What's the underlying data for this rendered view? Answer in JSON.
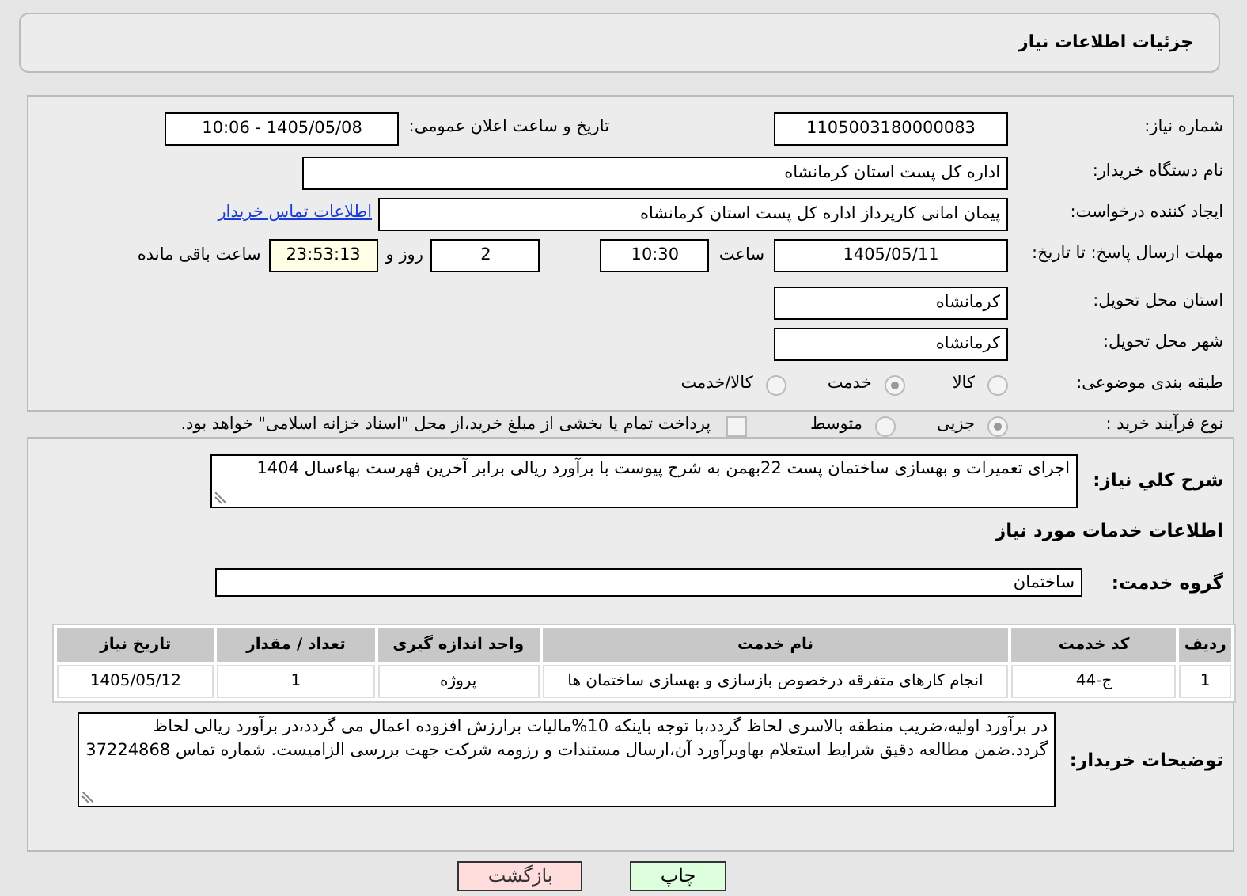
{
  "header": {
    "title": "جزئیات اطلاعات نیاز"
  },
  "need_number": {
    "label": "شماره نیاز:",
    "value": "1105003180000083"
  },
  "announce": {
    "label": "تاریخ و ساعت اعلان عمومی:",
    "value": "1405/05/08 - 10:06"
  },
  "buyer_org": {
    "label": "نام دستگاه خریدار:",
    "value": "اداره کل پست استان کرمانشاه"
  },
  "requester": {
    "label": "ایجاد کننده درخواست:",
    "value": "پیمان امانی کارپرداز اداره کل پست استان کرمانشاه",
    "link": "اطلاعات تماس خریدار"
  },
  "deadline": {
    "label": "مهلت ارسال پاسخ: تا تاریخ:",
    "date": "1405/05/11",
    "time_label": "ساعت",
    "time": "10:30",
    "days": "2",
    "days_label": "روز و",
    "remaining": "23:53:13",
    "remaining_label": "ساعت باقی مانده"
  },
  "province": {
    "label": "استان محل تحویل:",
    "value": "کرمانشاه"
  },
  "city": {
    "label": "شهر محل تحویل:",
    "value": "کرمانشاه"
  },
  "category": {
    "label": "طبقه بندی موضوعی:",
    "options": [
      {
        "label": "کالا",
        "selected": false
      },
      {
        "label": "خدمت",
        "selected": true
      },
      {
        "label": "کالا/خدمت",
        "selected": false
      }
    ]
  },
  "process": {
    "label": "نوع فرآیند خرید :",
    "options": [
      {
        "label": "جزیی",
        "selected": true
      },
      {
        "label": "متوسط",
        "selected": false
      }
    ],
    "payment": {
      "label": "پرداخت تمام یا بخشی از مبلغ خرید،از محل \"اسناد خزانه اسلامی\" خواهد بود.",
      "checked": false
    }
  },
  "summary": {
    "label": "شرح کلي نياز:",
    "value": "اجرای تعمیرات و بهسازی ساختمان پست 22بهمن به شرح پیوست با برآورد ریالی برابر آخرین فهرست بهاءسال 1404"
  },
  "services_title": "اطلاعات خدمات مورد نیاز",
  "service_group": {
    "label": "گروه خدمت:",
    "value": "ساختمان"
  },
  "table": {
    "columns": [
      "ردیف",
      "کد خدمت",
      "نام خدمت",
      "واحد اندازه گیری",
      "تعداد / مقدار",
      "تاریخ نیاز"
    ],
    "rows": [
      [
        "1",
        "ج-44",
        "انجام کارهای متفرقه درخصوص بازسازی و بهسازی ساختمان ها",
        "پروژه",
        "1",
        "1405/05/12"
      ]
    ]
  },
  "notes": {
    "label": "توضیحات خریدار:",
    "value": "در برآورد اولیه،ضریب منطقه بالاسری لحاظ گردد،با توجه باینکه 10%مالیات برارزش افزوده اعمال می گردد،در برآورد ریالی لحاظ گردد.ضمن مطالعه دقیق شرایط استعلام بهاوبرآورد آن،ارسال مستندات و رزومه شرکت جهت بررسی الزامیست. شماره تماس 37224868"
  },
  "buttons": [
    {
      "label": "چاپ",
      "kind": "print"
    },
    {
      "label": "بازگشت",
      "kind": "back"
    }
  ]
}
